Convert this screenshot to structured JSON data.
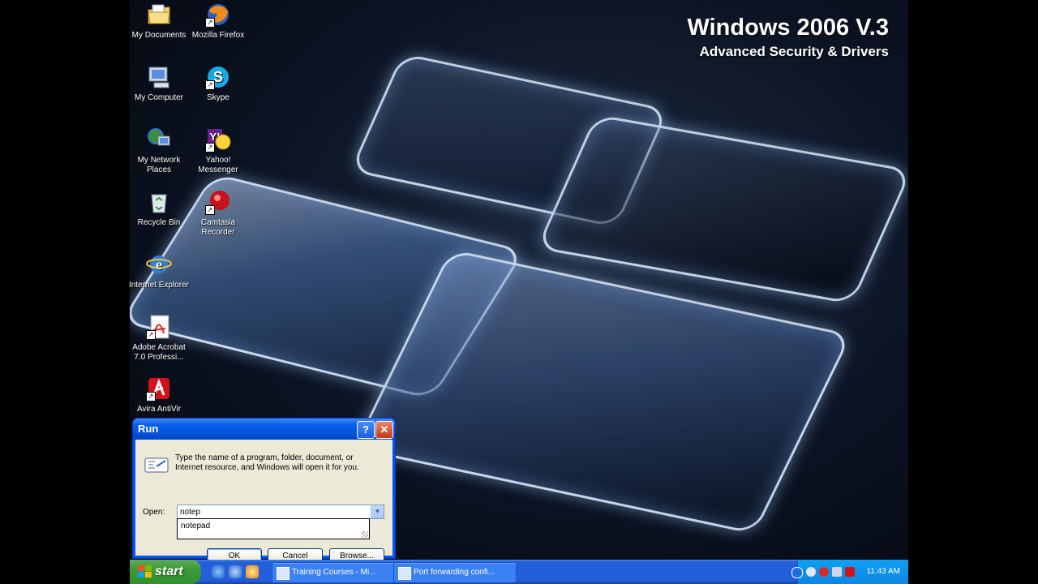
{
  "wallpaper": {
    "title": "Windows 2006 V.3",
    "subtitle": "Advanced Security & Drivers"
  },
  "desktop_icons": [
    {
      "label": "My Documents",
      "icon": "folder-documents-icon"
    },
    {
      "label": "Mozilla Firefox",
      "icon": "firefox-icon"
    },
    {
      "label": "My Computer",
      "icon": "computer-icon"
    },
    {
      "label": "Skype",
      "icon": "skype-icon"
    },
    {
      "label": "My Network Places",
      "icon": "network-places-icon"
    },
    {
      "label": "Yahoo! Messenger",
      "icon": "yahoo-messenger-icon"
    },
    {
      "label": "Recycle Bin",
      "icon": "recycle-bin-icon"
    },
    {
      "label": "Camtasia Recorder",
      "icon": "camtasia-recorder-icon"
    },
    {
      "label": "Internet Explorer",
      "icon": "internet-explorer-icon"
    },
    {
      "label": "Adobe Acrobat 7.0 Professi...",
      "icon": "adobe-acrobat-icon"
    },
    {
      "label": "Avira AntiVir",
      "icon": "avira-icon"
    }
  ],
  "run_dialog": {
    "title": "Run",
    "help_button": "?",
    "close_button": "✕",
    "description": "Type the name of a program, folder, document, or Internet resource, and Windows will open it for you.",
    "open_label": "Open:",
    "open_value": "notep",
    "autocomplete": [
      "notepad"
    ],
    "ok": "OK",
    "cancel": "Cancel",
    "browse": "Browse..."
  },
  "taskbar": {
    "start": "start",
    "tasks": [
      {
        "label": "Training Courses - Mi..."
      },
      {
        "label": "Port forwarding confi..."
      }
    ],
    "clock": "11:43 AM"
  }
}
